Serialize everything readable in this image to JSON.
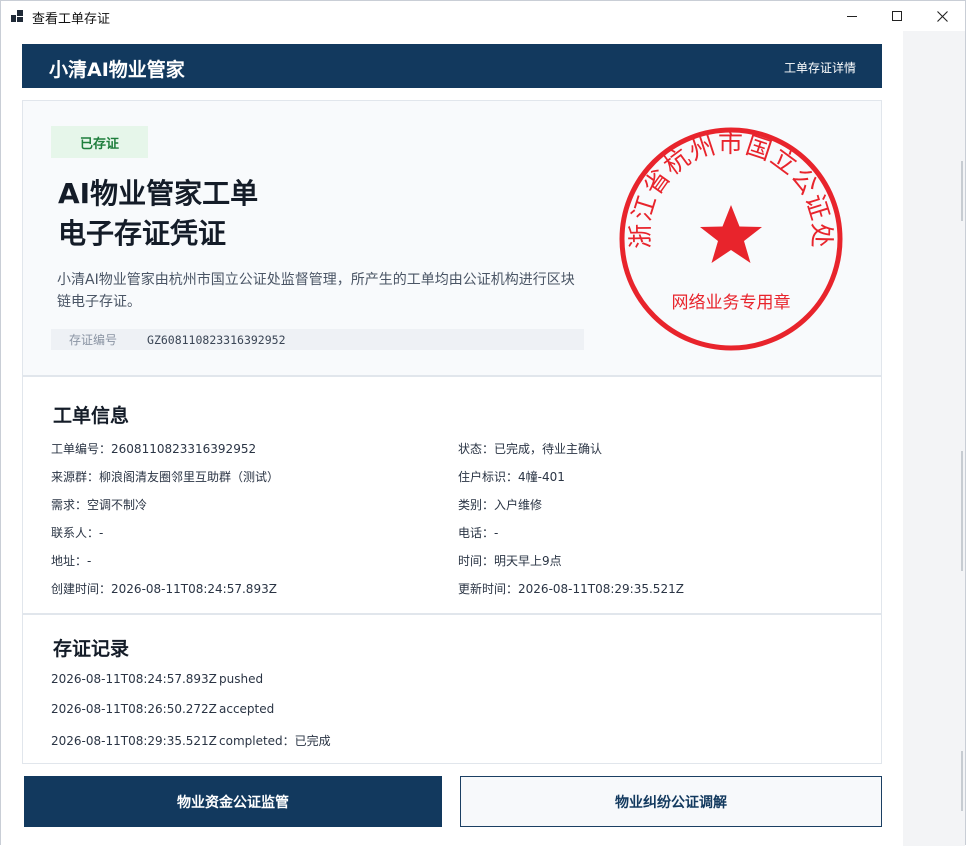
{
  "window": {
    "title": "查看工单存证",
    "minimize_glyph": "—",
    "maximize_glyph": "☐",
    "close_glyph": "✕"
  },
  "header": {
    "brand": "小清AI物业管家",
    "link": "工单存证详情"
  },
  "certificate": {
    "status_badge": "已存证",
    "title_line1": "AI物业管家工单",
    "title_line2": "电子存证凭证",
    "description": "小清AI物业管家由杭州市国立公证处监督管理，所产生的工单均由公证机构进行区块链电子存证。",
    "serial_label": "存证编号",
    "serial_value": "GZ608110823316392952",
    "seal": {
      "outer_text": "浙江省杭州市国立公证处",
      "inner_text": "网络业务专用章",
      "color": "#e8242c"
    }
  },
  "ticket": {
    "section_title": "工单信息",
    "fields": [
      {
        "key": "工单编号",
        "value": "2608110823316392952"
      },
      {
        "key": "状态",
        "value": "已完成，待业主确认"
      },
      {
        "key": "来源群",
        "value": "柳浪阁清友圈邻里互助群（测试）"
      },
      {
        "key": "住户标识",
        "value": "4幢-401"
      },
      {
        "key": "需求",
        "value": "空调不制冷"
      },
      {
        "key": "类别",
        "value": "入户维修"
      },
      {
        "key": "联系人",
        "value": "-"
      },
      {
        "key": "电话",
        "value": "-"
      },
      {
        "key": "地址",
        "value": "-"
      },
      {
        "key": "时间",
        "value": "明天早上9点"
      },
      {
        "key": "创建时间",
        "value": "2026-08-11T08:24:57.893Z"
      },
      {
        "key": "更新时间",
        "value": "2026-08-11T08:29:35.521Z"
      }
    ]
  },
  "records": {
    "section_title": "存证记录",
    "items": [
      {
        "time": "2026-08-11T08:24:57.893Z",
        "event": "pushed"
      },
      {
        "time": "2026-08-11T08:26:50.272Z",
        "event": "accepted"
      },
      {
        "time": "2026-08-11T08:29:35.521Z",
        "event": "completed：已完成"
      }
    ]
  },
  "actions": {
    "primary_label": "物业资金公证监管",
    "secondary_label": "物业纠纷公证调解"
  },
  "colors": {
    "navy": "#12395e",
    "badge_bg": "#e6f6ea",
    "badge_text": "#1e7e3c",
    "seal_red": "#e8242c"
  }
}
